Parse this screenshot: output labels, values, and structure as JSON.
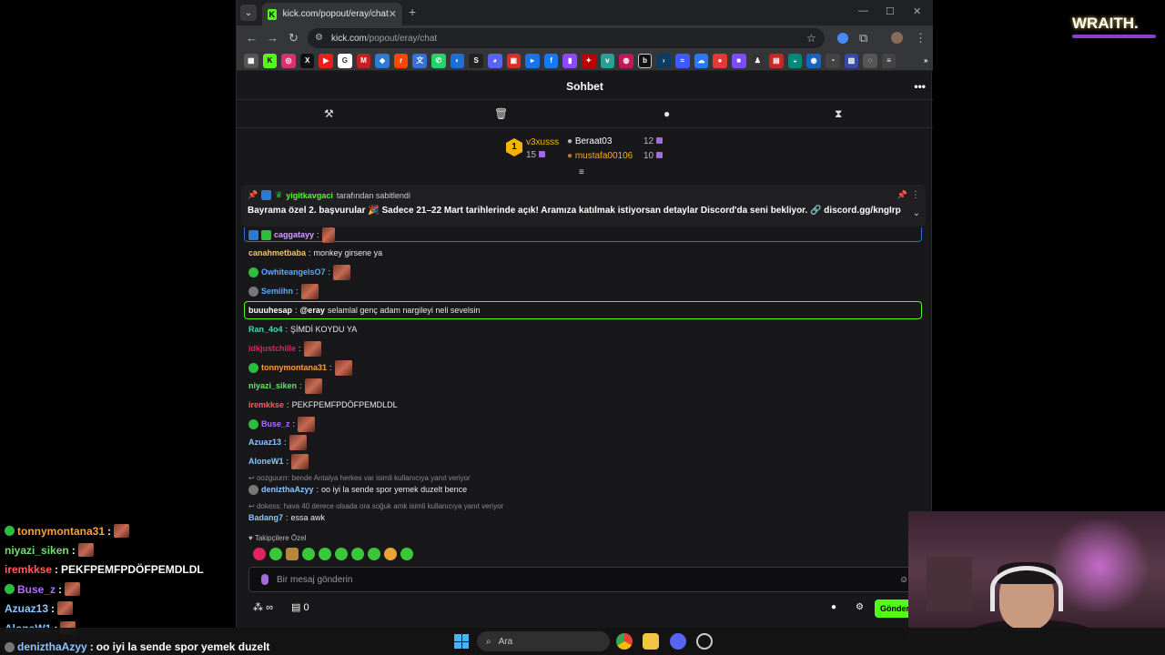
{
  "browser": {
    "tab_title": "kick.com/popout/eray/chat",
    "url_host": "kick.com",
    "url_path": "/popout/eray/chat"
  },
  "chat": {
    "title": "Sohbet",
    "leaderboard": [
      {
        "name": "v3xusss",
        "value": "15"
      },
      {
        "name": "Beraat03",
        "value": "12"
      },
      {
        "name": "mustafa00106",
        "value": "10"
      }
    ],
    "rank_badge": "1",
    "pinned": {
      "pinned_by": "yigitkavgaci",
      "suffix": "tarafından sabitlendi",
      "message": "Bayrama özel 2. başvurular 🎉 Sadece 21–22 Mart tarihlerinde açık! Aramıza katılmak istiyorsan detaylar Discord'da seni bekliyor. 🔗 discord.gg/kngIrp"
    },
    "messages": [
      {
        "user": "caggatayy",
        "text": ""
      },
      {
        "user": "canahmetbaba",
        "text": "monkey girsene ya"
      },
      {
        "user": "OwhiteangelsO7",
        "text": ""
      },
      {
        "user": "Semiihn",
        "text": ""
      },
      {
        "user": "buuuhesap",
        "mention": "@eray",
        "text": "selamlal genç adam nargileyi neli sevelsin"
      },
      {
        "user": "Ran_4o4",
        "text": "ŞİMDİ KOYDU YA"
      },
      {
        "user": "idkjustchille",
        "text": ""
      },
      {
        "user": "tonnymontana31",
        "text": ""
      },
      {
        "user": "niyazi_siken",
        "text": ""
      },
      {
        "user": "iremkkse",
        "text": "PEKFPEMFPDÖFPEMDLDL"
      },
      {
        "user": "Buse_z",
        "text": ""
      },
      {
        "user": "Azuaz13",
        "text": ""
      },
      {
        "user": "AloneW1",
        "text": ""
      },
      {
        "reply": "oozguurrr: bende Antalya herkes var isimli kullanıcıya yanıt veriyor"
      },
      {
        "user": "denizthaAzyy",
        "text": "oo iyi la sende spor yemek duzelt bence"
      },
      {
        "reply": "dokess: hava 40 derece olsada ora soğuk amk isimli kullanıcıya yanıt veriyor"
      },
      {
        "user": "Badang7",
        "text": "essa awk"
      }
    ],
    "followers_only_label": "Takipçilere Özel",
    "input_placeholder": "Bir mesaj gönderin",
    "infinity": "∞",
    "count": "0",
    "send_label": "Gönder"
  },
  "overlay": {
    "brand": "WRAITH.",
    "chat": [
      {
        "user": "tonnymontana31",
        "text": ""
      },
      {
        "user": "niyazi_siken",
        "text": ""
      },
      {
        "user": "iremkkse",
        "text": "PEKFPEMFPDÖFPEMDLDL"
      },
      {
        "user": "Buse_z",
        "text": ""
      },
      {
        "user": "Azuaz13",
        "text": ""
      },
      {
        "user": "AloneW1",
        "text": ""
      },
      {
        "user": "denizthaAzyy",
        "text": "oo iyi la sende spor yemek duzelt"
      }
    ]
  },
  "taskbar": {
    "search_label": "Ara"
  },
  "colors": {
    "kick_green": "#53fc18",
    "accent_purple": "#a56bdb"
  }
}
